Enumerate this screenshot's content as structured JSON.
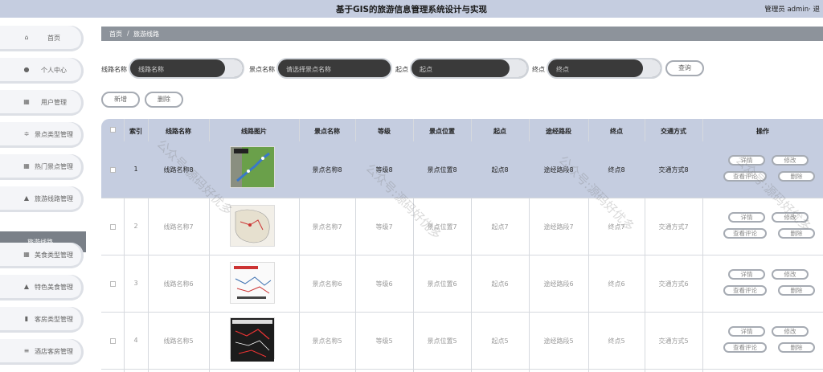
{
  "header": {
    "title": "基于GIS的旅游信息管理系统设计与实现",
    "user": "管理员 admin· 退"
  },
  "sidebar": {
    "items": [
      {
        "label": "首页",
        "icon": "home-icon"
      },
      {
        "label": "个人中心",
        "icon": "user-icon"
      },
      {
        "label": "用户管理",
        "icon": "grid-icon"
      },
      {
        "label": "景点类型管理",
        "icon": "sliders-icon"
      },
      {
        "label": "热门景点管理",
        "icon": "grid-icon"
      },
      {
        "label": "旅游线路管理",
        "icon": "bank-icon"
      },
      {
        "label": "美食类型管理",
        "icon": "grid-icon"
      },
      {
        "label": "特色美食管理",
        "icon": "bank-icon"
      },
      {
        "label": "客房类型管理",
        "icon": "bar-chart-icon"
      },
      {
        "label": "酒店客房管理",
        "icon": "list-icon"
      }
    ],
    "active_sub": "旅游线路"
  },
  "breadcrumb": {
    "home": "首页",
    "sep": "/",
    "current": "旅游线路"
  },
  "search": {
    "route_name_label": "线路名称",
    "route_name_placeholder": "线路名称",
    "spot_name_label": "景点名称",
    "spot_name_placeholder": "请选择景点名称",
    "start_label": "起点",
    "start_placeholder": "起点",
    "end_label": "终点",
    "end_placeholder": "终点",
    "query_button": "查询"
  },
  "actions": {
    "add": "新增",
    "delete": "删除"
  },
  "table": {
    "headers": [
      "索引",
      "线路名称",
      "线路图片",
      "景点名称",
      "等级",
      "景点位置",
      "起点",
      "途经路段",
      "终点",
      "交通方式",
      "操作"
    ],
    "op_labels": {
      "detail": "详情",
      "edit": "修改",
      "comments": "查看评论",
      "delete": "删除"
    },
    "rows": [
      {
        "index": "1",
        "route": "线路名称8",
        "spot": "景点名称8",
        "level": "等级8",
        "location": "景点位置8",
        "start": "起点8",
        "via": "途经路段8",
        "end": "终点8",
        "transport": "交通方式8"
      },
      {
        "index": "2",
        "route": "线路名称7",
        "spot": "景点名称7",
        "level": "等级7",
        "location": "景点位置7",
        "start": "起点7",
        "via": "途经路段7",
        "end": "终点7",
        "transport": "交通方式7"
      },
      {
        "index": "3",
        "route": "线路名称6",
        "spot": "景点名称6",
        "level": "等级6",
        "location": "景点位置6",
        "start": "起点6",
        "via": "途经路段6",
        "end": "终点6",
        "transport": "交通方式6"
      },
      {
        "index": "4",
        "route": "线路名称5",
        "spot": "景点名称5",
        "level": "等级5",
        "location": "景点位置5",
        "start": "起点5",
        "via": "途经路段5",
        "end": "终点5",
        "transport": "交通方式5"
      }
    ]
  },
  "watermark": "公众号:源码好优多"
}
